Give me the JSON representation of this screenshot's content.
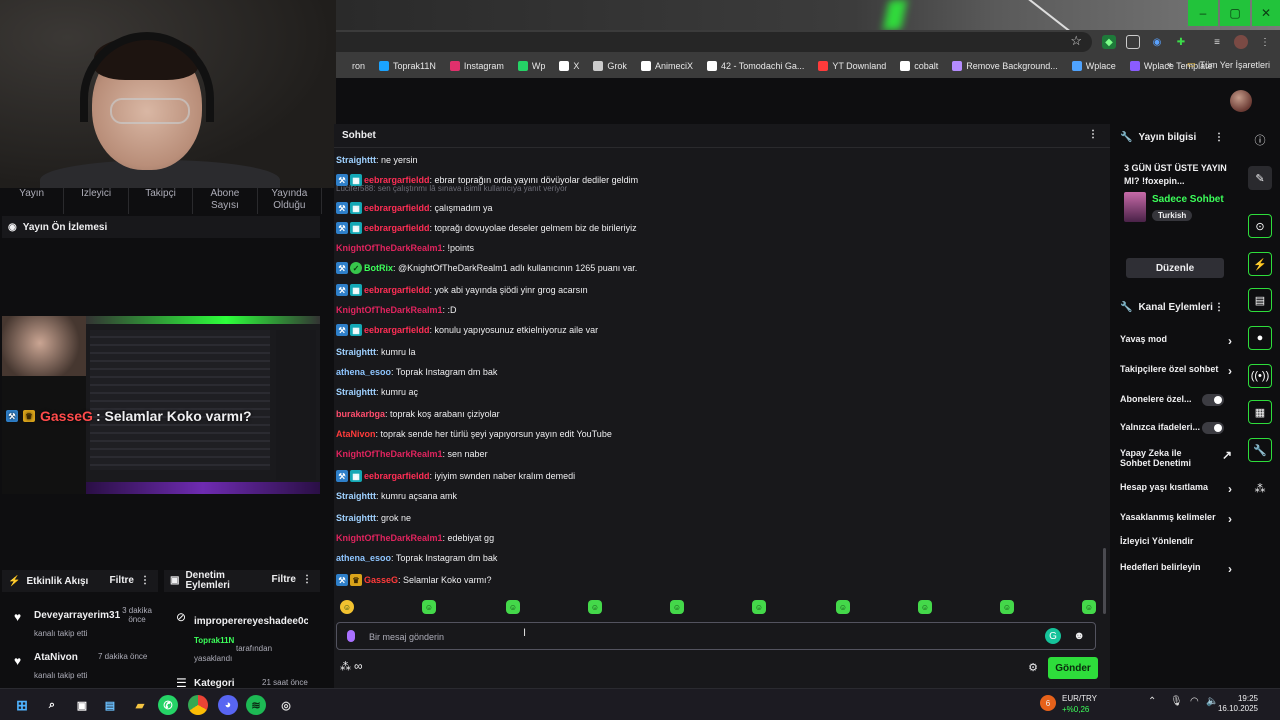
{
  "browser": {
    "bookmarks": [
      {
        "label": "ron",
        "color": "#00000000"
      },
      {
        "label": "Toprak11N",
        "color": "#1aa3ff"
      },
      {
        "label": "Instagram",
        "color": "#e1306c"
      },
      {
        "label": "Wp",
        "color": "#25d366"
      },
      {
        "label": "X",
        "color": "#ffffff"
      },
      {
        "label": "Grok",
        "color": "#cccccc"
      },
      {
        "label": "AnimeciX",
        "color": "#ffffff"
      },
      {
        "label": "42 - Tomodachi Ga...",
        "color": "#ffffff"
      },
      {
        "label": "YT Downland",
        "color": "#ff3b3b"
      },
      {
        "label": "cobalt",
        "color": "#ffffff"
      },
      {
        "label": "Remove Background...",
        "color": "#b58cff"
      },
      {
        "label": "Wplace",
        "color": "#4fa3ff"
      },
      {
        "label": "Wplace Template",
        "color": "#8a5cff"
      }
    ],
    "all_bookmarks": "Tüm Yer İşaretleri",
    "bookmarks_overflow": "»"
  },
  "dashboard": {
    "stats": [
      "Yayın",
      "İzleyici",
      "Takipçi",
      "Abone Sayısı",
      "Yayında Olduğu"
    ],
    "preview_title": "Yayın Ön İzlemesi",
    "preview_overlay_user": "GasseG",
    "preview_overlay_text": ": Selamlar Koko varmı?",
    "activity": {
      "title": "Etkinlik Akışı",
      "filter": "Filtre",
      "items": [
        {
          "user": "Deveyarrayerim31",
          "action": "kanalı takip etti",
          "time": "3 dakika önce"
        },
        {
          "user": "AtaNivon",
          "action": "kanalı takip etti",
          "time": "7 dakika önce"
        }
      ]
    },
    "moderation": {
      "title": "Denetim Eylemleri",
      "filter": "Filtre",
      "items": [
        {
          "user": "improperereyeshadee0cpdc",
          "by": "Toprak11N",
          "action": "tarafından yasaklandı",
          "time": ""
        },
        {
          "user": "Kategori",
          "by": "",
          "action": "",
          "time": "21 saat önce"
        }
      ]
    }
  },
  "chat": {
    "title": "Sohbet",
    "reply_context": "Lucifer588: sen çalıştınmı lâ sınava isimli kullanıcıya yanıt veriyor",
    "messages": [
      {
        "badges": [],
        "user": "Straighttt",
        "color": "#9fd1ff",
        "text": ": ne yersin"
      },
      {
        "badges": [
          "b-blue",
          "b-teal"
        ],
        "user": "eebrargarfieldd",
        "color": "#ff2e55",
        "text": ": ebrar toprağın orda yayını dövüyolar dediler geldim"
      },
      {
        "badges": [
          "b-blue",
          "b-teal"
        ],
        "user": "eebrargarfieldd",
        "color": "#ff2e55",
        "text": ": çalışmadım ya"
      },
      {
        "badges": [
          "b-blue",
          "b-teal"
        ],
        "user": "eebrargarfieldd",
        "color": "#ff2e55",
        "text": ": toprağı dovuyolae deseler gelmem biz de birileriyiz"
      },
      {
        "badges": [],
        "user": "KnightOfTheDarkRealm1",
        "color": "#e0245e",
        "text": ": !points"
      },
      {
        "badges": [
          "b-blue",
          "b-green"
        ],
        "user": "BotRix",
        "color": "#3cff5a",
        "text": ": @KnightOfTheDarkRealm1 adlı kullanıcının 1265 puanı var."
      },
      {
        "badges": [
          "b-blue",
          "b-teal"
        ],
        "user": "eebrargarfieldd",
        "color": "#ff2e55",
        "text": ": yok abi yayında şiödi yinr grog acarsın"
      },
      {
        "badges": [],
        "user": "KnightOfTheDarkRealm1",
        "color": "#e0245e",
        "text": ": :D"
      },
      {
        "badges": [
          "b-blue",
          "b-teal"
        ],
        "user": "eebrargarfieldd",
        "color": "#ff2e55",
        "text": ": konulu yapıyosunuz etkielniyoruz aile var"
      },
      {
        "badges": [],
        "user": "Straighttt",
        "color": "#9fd1ff",
        "text": ": kumru la"
      },
      {
        "badges": [],
        "user": "athena_esoo",
        "color": "#8ec5ff",
        "text": ": Toprak Instagram dm bak"
      },
      {
        "badges": [],
        "user": "Straighttt",
        "color": "#9fd1ff",
        "text": ": kumru aç"
      },
      {
        "badges": [],
        "user": "burakarbga",
        "color": "#ff4d6d",
        "text": ": toprak koş arabanı çiziyolar"
      },
      {
        "badges": [],
        "user": "AtaNivon",
        "color": "#ff3b3b",
        "text": ": toprak sende her türlü şeyi yapıyorsun yayın edit YouTube"
      },
      {
        "badges": [],
        "user": "KnightOfTheDarkRealm1",
        "color": "#e0245e",
        "text": ": sen naber"
      },
      {
        "badges": [
          "b-blue",
          "b-teal"
        ],
        "user": "eebrargarfieldd",
        "color": "#ff2e55",
        "text": ": iyiyim swnden naber kralım demedi"
      },
      {
        "badges": [],
        "user": "Straighttt",
        "color": "#9fd1ff",
        "text": ": kumru açsana amk"
      },
      {
        "badges": [],
        "user": "Straighttt",
        "color": "#9fd1ff",
        "text": ": grok ne"
      },
      {
        "badges": [],
        "user": "KnightOfTheDarkRealm1",
        "color": "#e0245e",
        "text": ": edebiyat gg"
      },
      {
        "badges": [],
        "user": "athena_esoo",
        "color": "#8ec5ff",
        "text": ": Toprak Instagram dm bak"
      },
      {
        "badges": [
          "b-blue",
          "b-gold"
        ],
        "user": "GasseG",
        "color": "#ff3b3b",
        "text": ": Selamlar Koko varmı?"
      }
    ],
    "input_placeholder": "Bir mesaj gönderin",
    "send_label": "Gönder"
  },
  "stream_info": {
    "title": "Yayın bilgisi",
    "stream_title": "3 GÜN ÜST ÜSTE YAYIN MI? !foxepin...",
    "category": "Sadece Sohbet",
    "tag": "Turkish",
    "edit_label": "Düzenle"
  },
  "channel_actions": {
    "title": "Kanal Eylemleri",
    "items": [
      {
        "label": "Yavaş mod",
        "kind": "arrow"
      },
      {
        "label": "Takipçilere özel sohbet",
        "kind": "arrow"
      },
      {
        "label": "Abonelere özel...",
        "kind": "toggle"
      },
      {
        "label": "Yalnızca ifadeleri...",
        "kind": "toggle"
      },
      {
        "label": "Yapay Zeka ile Sohbet Denetimi",
        "kind": "external"
      },
      {
        "label": "Hesap yaşı kısıtlama",
        "kind": "arrow"
      },
      {
        "label": "Yasaklanmış kelimeler",
        "kind": "arrow"
      },
      {
        "label": "İzleyici Yönlendir",
        "kind": "none"
      },
      {
        "label": "Hedefleri belirleyin",
        "kind": "arrow"
      }
    ]
  },
  "taskbar": {
    "ticker_name": "EUR/TRY",
    "ticker_change": "+%0,26",
    "ticker_badge": "6",
    "time": "19:25",
    "date": "16.10.2025"
  }
}
